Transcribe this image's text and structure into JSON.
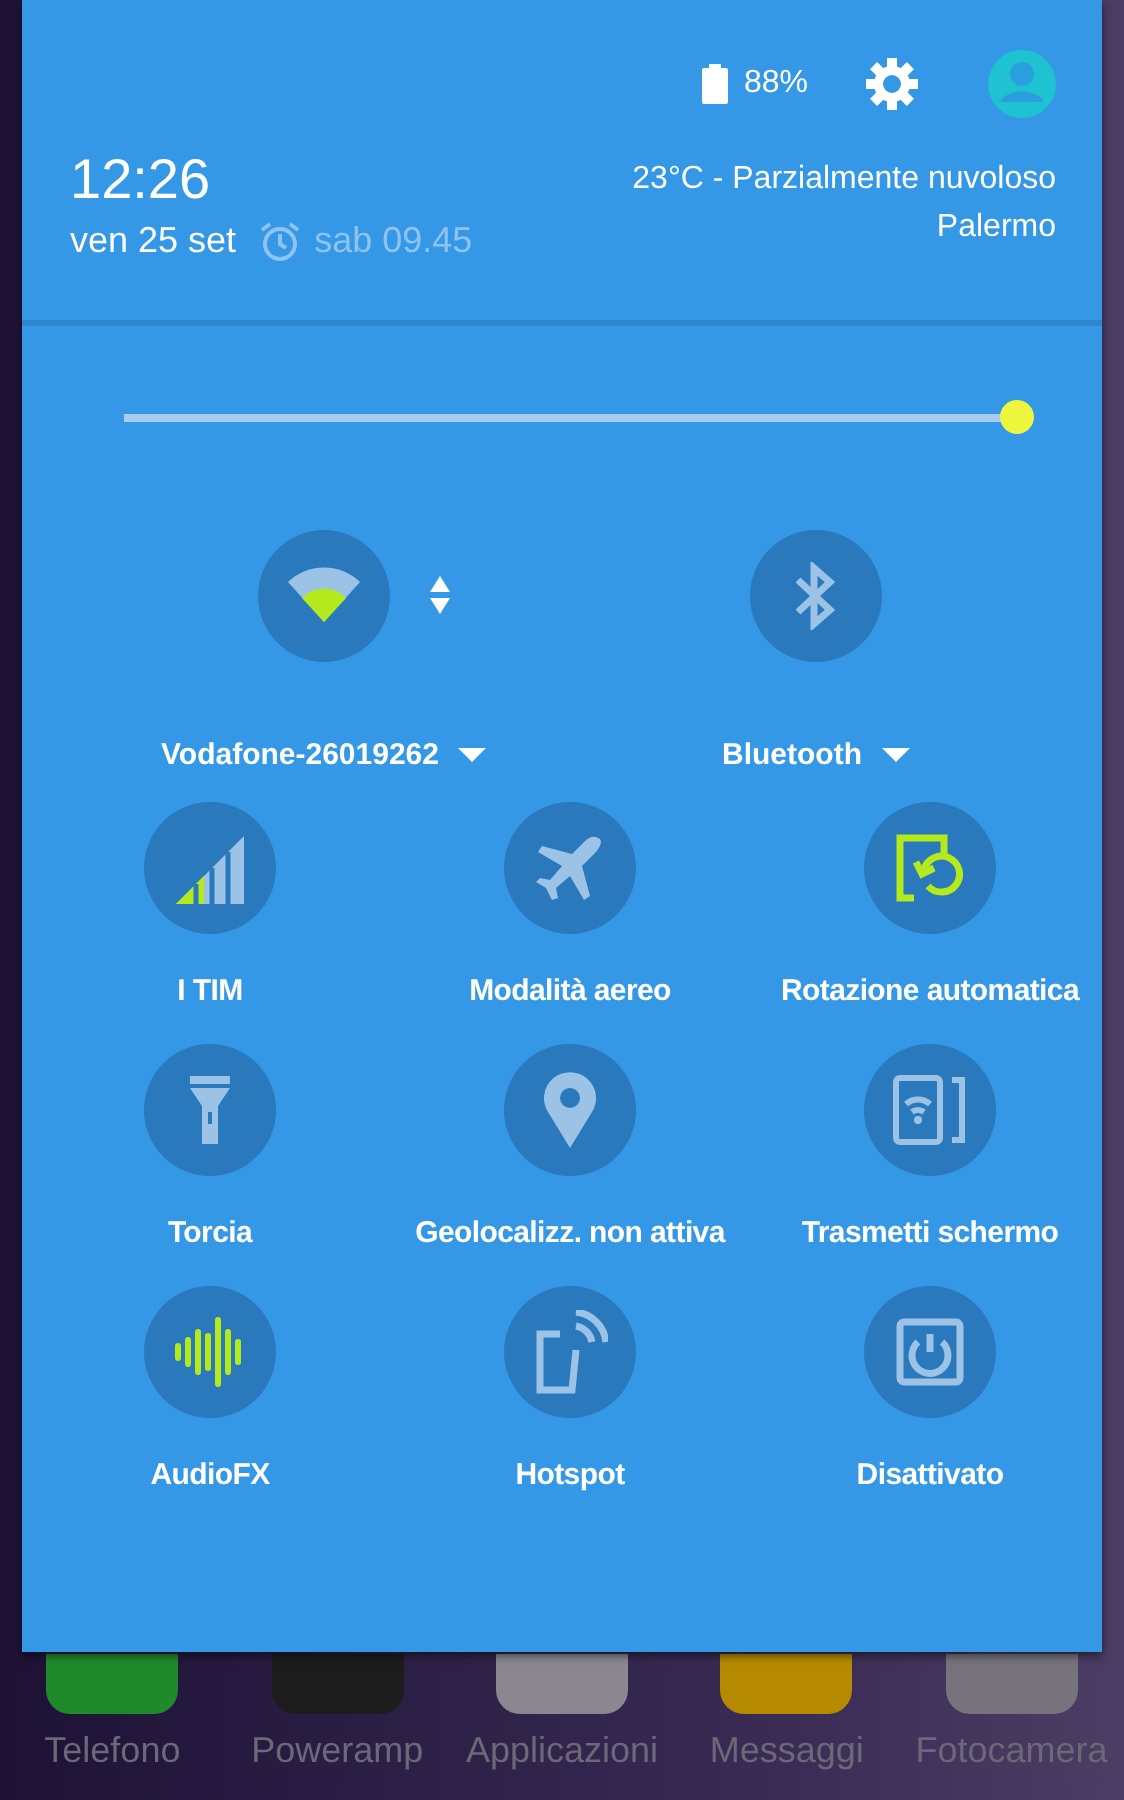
{
  "status": {
    "battery": "88%"
  },
  "clock": {
    "time": "12:26",
    "date": "ven 25 set",
    "alarm": "sab 09.45"
  },
  "weather": {
    "summary": "23°C - Parzialmente nuvoloso",
    "location": "Palermo"
  },
  "brightness": {
    "level": 1.0
  },
  "main_toggles": [
    {
      "label": "Vodafone-26019262",
      "kind": "wifi",
      "on": true
    },
    {
      "label": "Bluetooth",
      "kind": "bluetooth",
      "on": false
    }
  ],
  "tiles": [
    {
      "label": "I TIM",
      "kind": "signal",
      "on": true
    },
    {
      "label": "Modalità aereo",
      "kind": "airplane",
      "on": false
    },
    {
      "label": "Rotazione automatica",
      "kind": "rotate",
      "on": true
    },
    {
      "label": "Torcia",
      "kind": "flashlight",
      "on": false
    },
    {
      "label": "Geolocalizz. non attiva",
      "kind": "location",
      "on": false
    },
    {
      "label": "Trasmetti schermo",
      "kind": "cast",
      "on": false
    },
    {
      "label": "AudioFX",
      "kind": "audio",
      "on": true
    },
    {
      "label": "Hotspot",
      "kind": "hotspot",
      "on": false
    },
    {
      "label": "Disattivato",
      "kind": "power",
      "on": false
    }
  ],
  "dock": [
    {
      "label": "Telefono",
      "color": "#1f8a2a"
    },
    {
      "label": "Poweramp",
      "color": "#1c1c1c"
    },
    {
      "label": "Applicazioni",
      "color": "#8a8790"
    },
    {
      "label": "Messaggi",
      "color": "#b58a00"
    },
    {
      "label": "Fotocamera",
      "color": "#77737d"
    }
  ]
}
